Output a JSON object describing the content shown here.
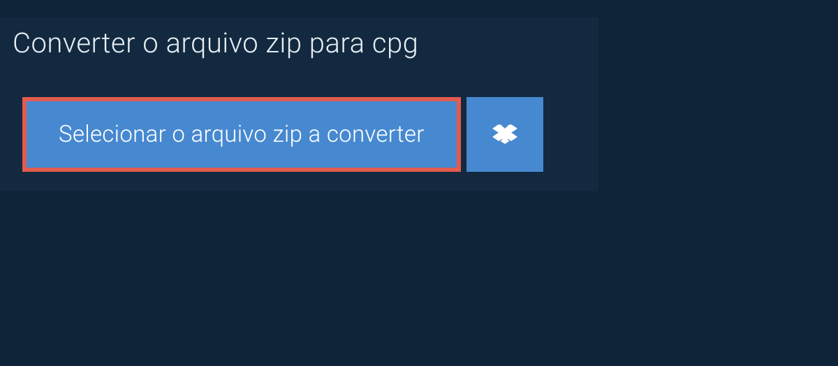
{
  "header": {
    "title": "Converter o arquivo zip para cpg"
  },
  "actions": {
    "select_file_label": "Selecionar o arquivo zip a converter",
    "dropbox_icon": "dropbox-icon"
  },
  "colors": {
    "background": "#0e2338",
    "panel": "#12293f",
    "button": "#4789d0",
    "highlight_border": "#e35b4e",
    "text": "#e6eef5"
  }
}
